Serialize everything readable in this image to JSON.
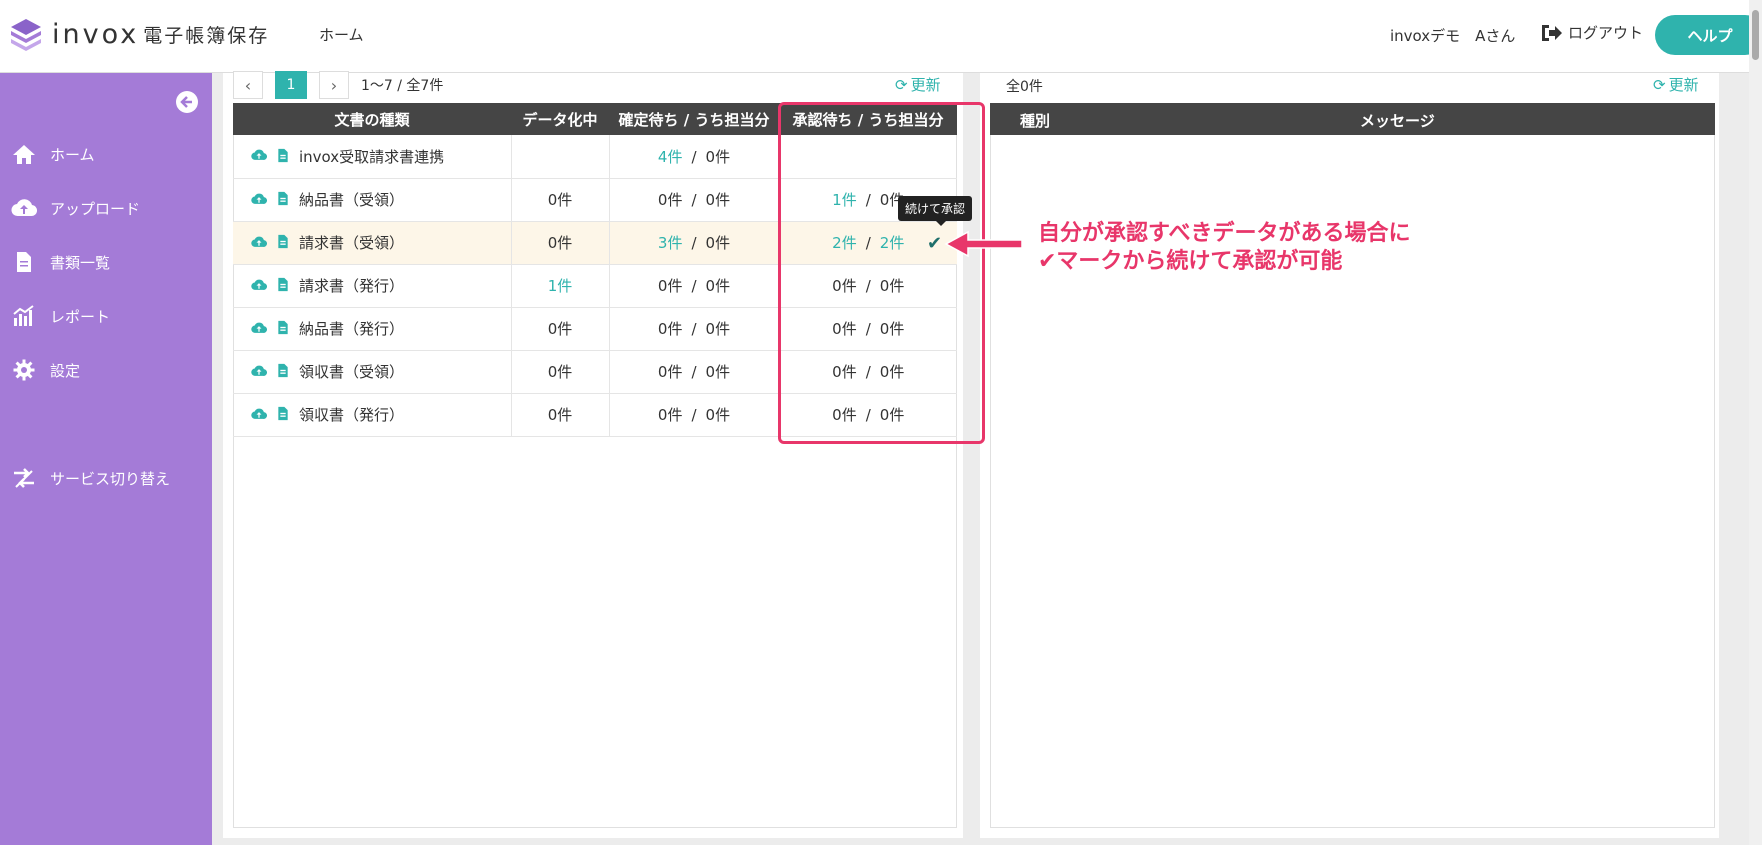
{
  "header": {
    "logo_text": "invox",
    "logo_sub": "電子帳簿保存",
    "nav_home": "ホーム",
    "user_name": "invoxデモ　Aさん",
    "logout": "ログアウト",
    "help": "ヘルプ"
  },
  "sidebar": {
    "items": [
      {
        "label": "ホーム",
        "icon": "home-icon"
      },
      {
        "label": "アップロード",
        "icon": "cloud-upload-icon"
      },
      {
        "label": "書類一覧",
        "icon": "document-icon"
      },
      {
        "label": "レポート",
        "icon": "report-icon"
      },
      {
        "label": "設定",
        "icon": "gear-icon"
      },
      {
        "label": "サービス切り替え",
        "icon": "switch-icon"
      }
    ]
  },
  "left_panel": {
    "pager": {
      "current": "1",
      "range_text": "1〜7 / 全7件"
    },
    "refresh": "更新",
    "columns": [
      "文書の種類",
      "データ化中",
      "確定待ち / うち担当分",
      "承認待ち / うち担当分"
    ],
    "rows": [
      {
        "name": "invox受取請求書連携",
        "datafying": "",
        "confirm_a": "4件",
        "confirm_b": "0件",
        "approve_a": "",
        "approve_b": ""
      },
      {
        "name": "納品書（受領）",
        "datafying": "0件",
        "confirm_a": "0件",
        "confirm_b": "0件",
        "approve_a": "1件",
        "approve_b": "0件"
      },
      {
        "name": "請求書（受領）",
        "datafying": "0件",
        "confirm_a": "3件",
        "confirm_b": "0件",
        "approve_a": "2件",
        "approve_b": "2件"
      },
      {
        "name": "請求書（発行）",
        "datafying": "1件",
        "confirm_a": "0件",
        "confirm_b": "0件",
        "approve_a": "0件",
        "approve_b": "0件"
      },
      {
        "name": "納品書（発行）",
        "datafying": "0件",
        "confirm_a": "0件",
        "confirm_b": "0件",
        "approve_a": "0件",
        "approve_b": "0件"
      },
      {
        "name": "領収書（受領）",
        "datafying": "0件",
        "confirm_a": "0件",
        "confirm_b": "0件",
        "approve_a": "0件",
        "approve_b": "0件"
      },
      {
        "name": "領収書（発行）",
        "datafying": "0件",
        "confirm_a": "0件",
        "confirm_b": "0件",
        "approve_a": "0件",
        "approve_b": "0件"
      }
    ],
    "tooltip": "続けて承認"
  },
  "right_panel": {
    "count": "全0件",
    "refresh": "更新",
    "columns": [
      "種別",
      "メッセージ"
    ]
  },
  "annotation": {
    "line1": "自分が承認すべきデータがある場合に",
    "line2": "✔マークから続けて承認が可能"
  },
  "colors": {
    "accent": "#2fb3ad",
    "sidebar": "#a47bd7",
    "highlight": "#e8366a",
    "table_header": "#454545"
  }
}
